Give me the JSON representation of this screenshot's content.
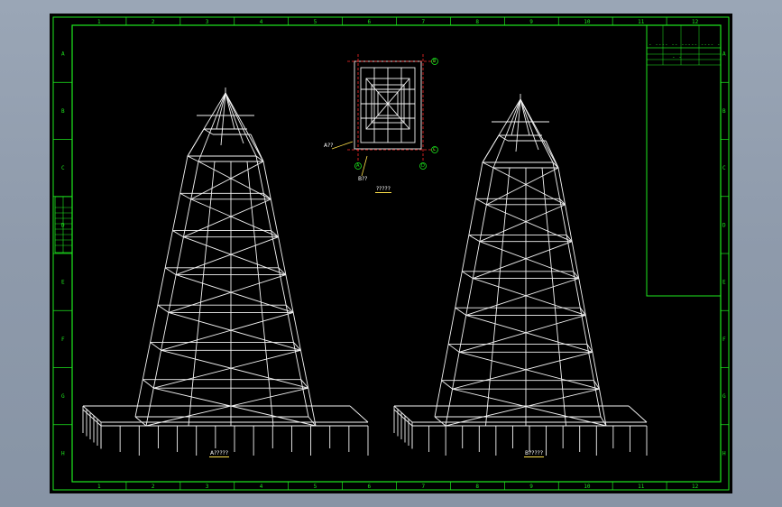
{
  "drawing": {
    "col_numbers": [
      "1",
      "2",
      "3",
      "4",
      "5",
      "6",
      "7",
      "8",
      "9",
      "10",
      "11",
      "12"
    ],
    "row_letters": [
      "A",
      "B",
      "C",
      "D",
      "E",
      "F",
      "G",
      "H"
    ],
    "plan_caption": "?????",
    "view_a_caption": "A?????",
    "view_b_caption": "B?????",
    "callout_a": "A??",
    "callout_b": "B??",
    "plan_axis_top_right": "B",
    "plan_axis_bottom_right": "C",
    "plan_axis_bottom_left": "A",
    "plan_axis_bottom_right2": "D"
  },
  "colors": {
    "frame": "#1ee81e",
    "background": "#000000",
    "linework": "#f4f4f4",
    "dimension": "#ff2a2a",
    "note_underline": "#ffe14a"
  }
}
